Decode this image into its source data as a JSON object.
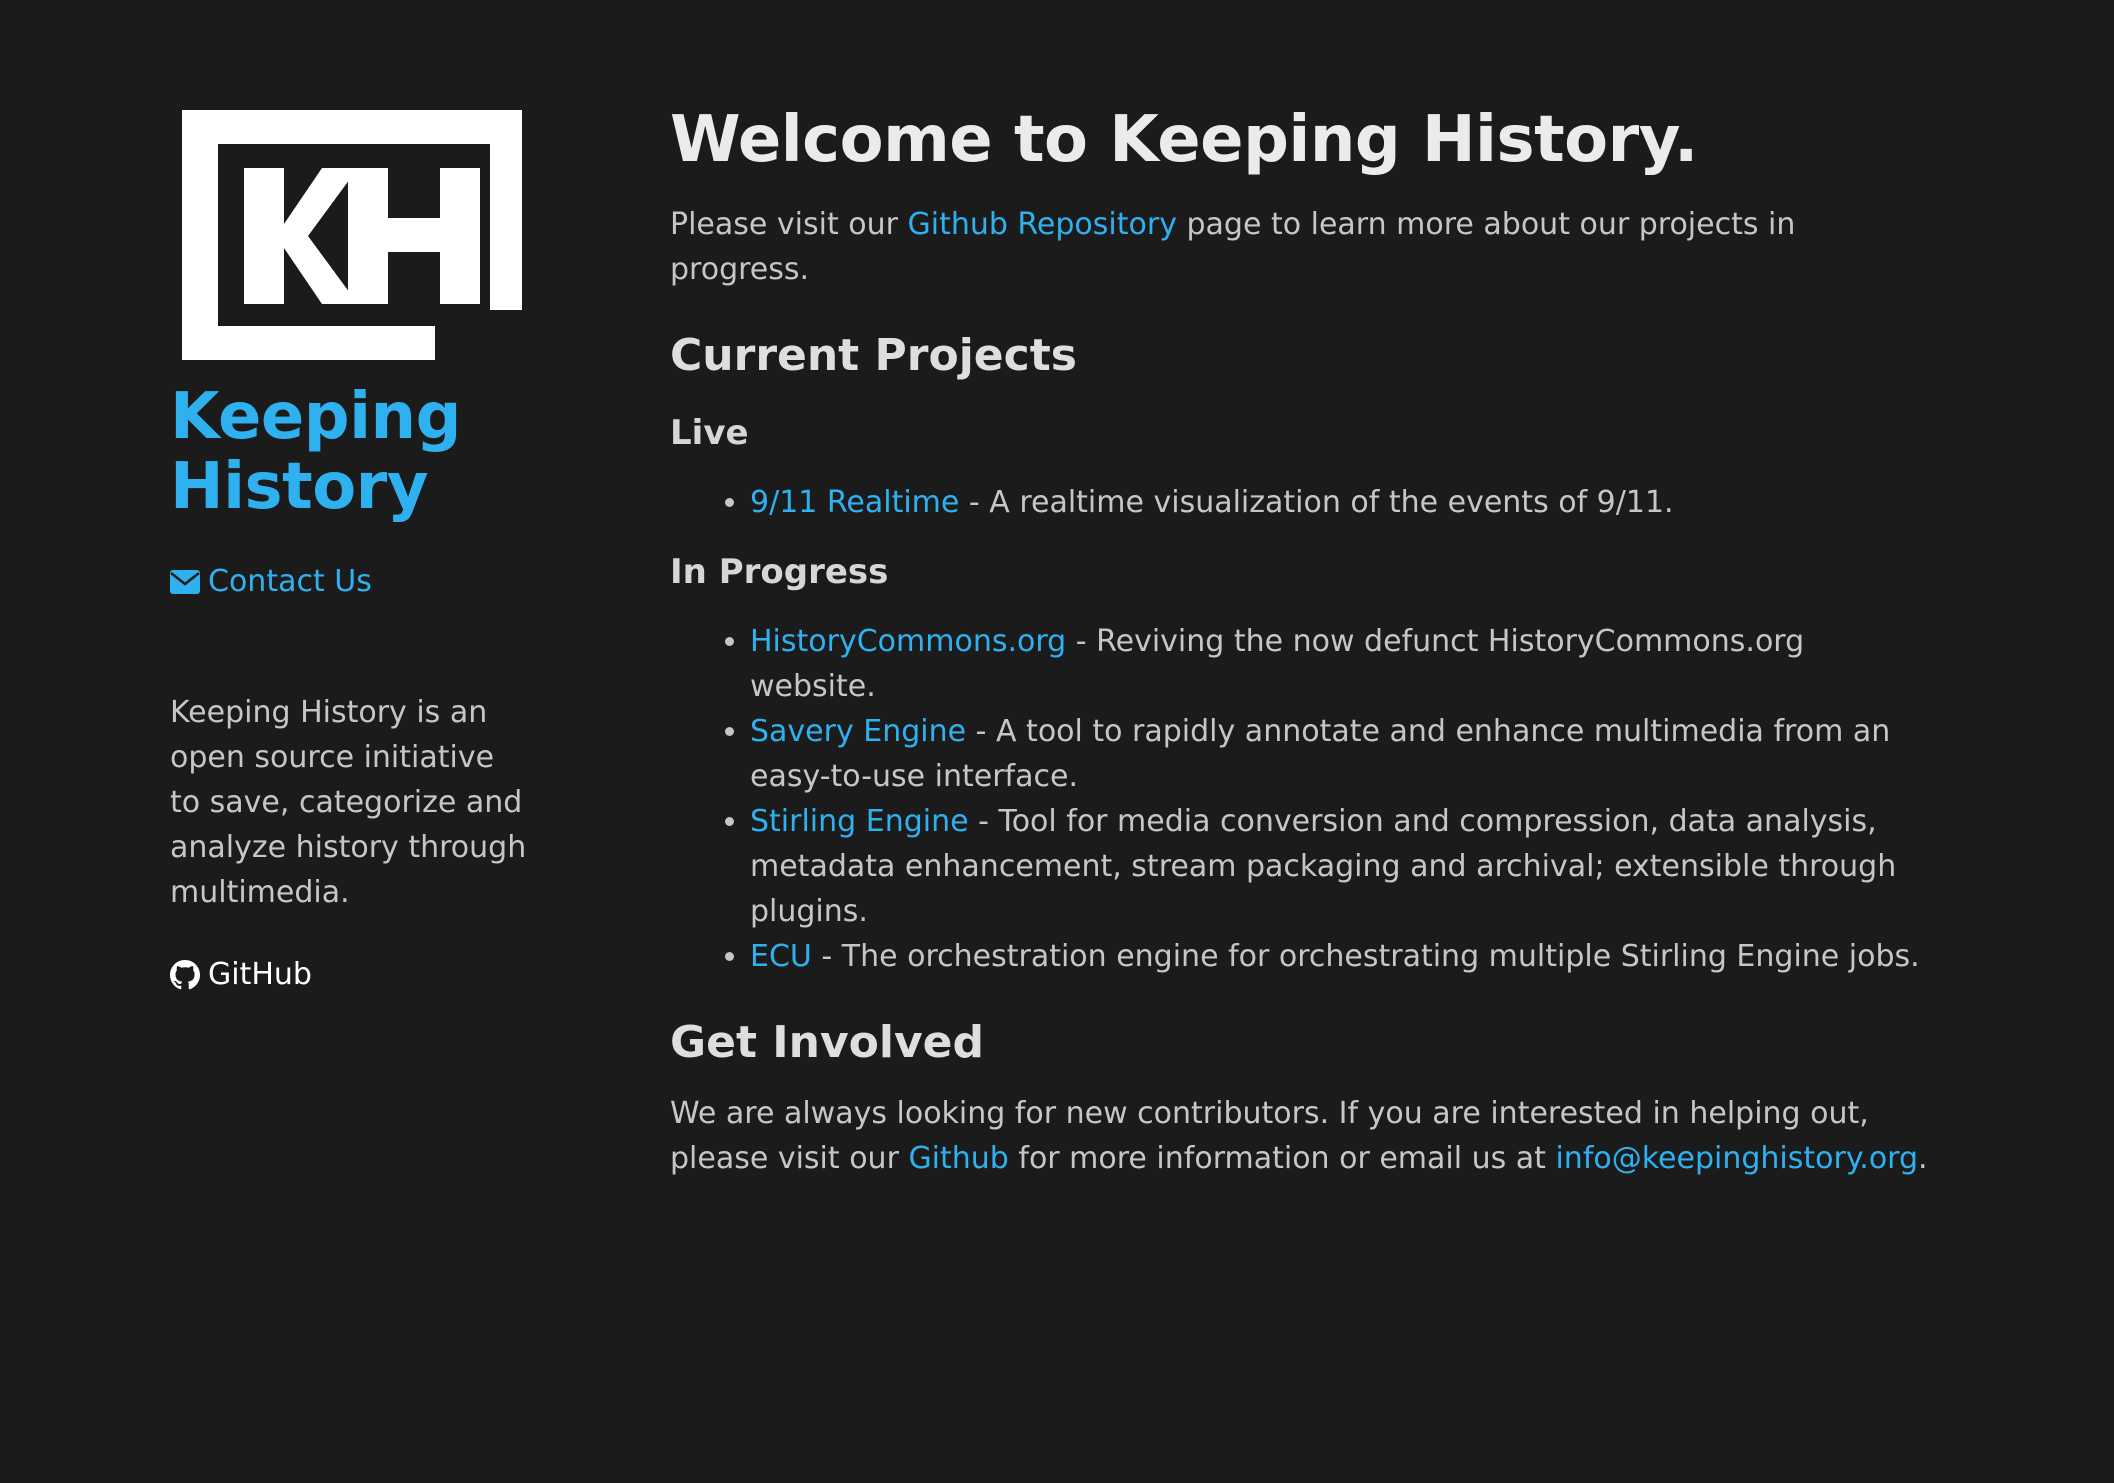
{
  "sidebar": {
    "logo_text": "KH",
    "title_line1": "Keeping",
    "title_line2": "History",
    "contact_label": "Contact Us",
    "about": "Keeping History is an open source initiative to save, categorize and analyze history through multimedia.",
    "github_label": "GitHub"
  },
  "main": {
    "heading": "Welcome to Keeping History.",
    "intro": {
      "before": "Please visit our ",
      "link": "Github Repository",
      "after": " page to learn more about our projects in progress."
    },
    "current_projects_heading": "Current Projects",
    "live_heading": "Live",
    "live_items": [
      {
        "name": "9/11 Realtime",
        "desc": " - A realtime visualization of the events of 9/11."
      }
    ],
    "in_progress_heading": "In Progress",
    "in_progress_items": [
      {
        "name": "HistoryCommons.org",
        "desc": " - Reviving the now defunct HistoryCommons.org website."
      },
      {
        "name": "Savery Engine",
        "desc": " - A tool to rapidly annotate and enhance multimedia from an easy-to-use interface."
      },
      {
        "name": "Stirling Engine",
        "desc": " - Tool for media conversion and compression, data analysis, metadata enhancement, stream packaging and archival; extensible through plugins."
      },
      {
        "name": "ECU",
        "desc": " - The orchestration engine for orchestrating multiple Stirling Engine jobs."
      }
    ],
    "get_involved_heading": "Get Involved",
    "get_involved": {
      "before": "We are always looking for new contributors. If you are interested in helping out, please visit our ",
      "link": "Github",
      "middle": " for more information or email us at ",
      "email": "info@keepinghistory.org",
      "after": "."
    }
  },
  "colors": {
    "background": "#1b1b1b",
    "accent": "#2fb1f0",
    "text": "#c6c6c6",
    "heading": "#ebebeb"
  }
}
